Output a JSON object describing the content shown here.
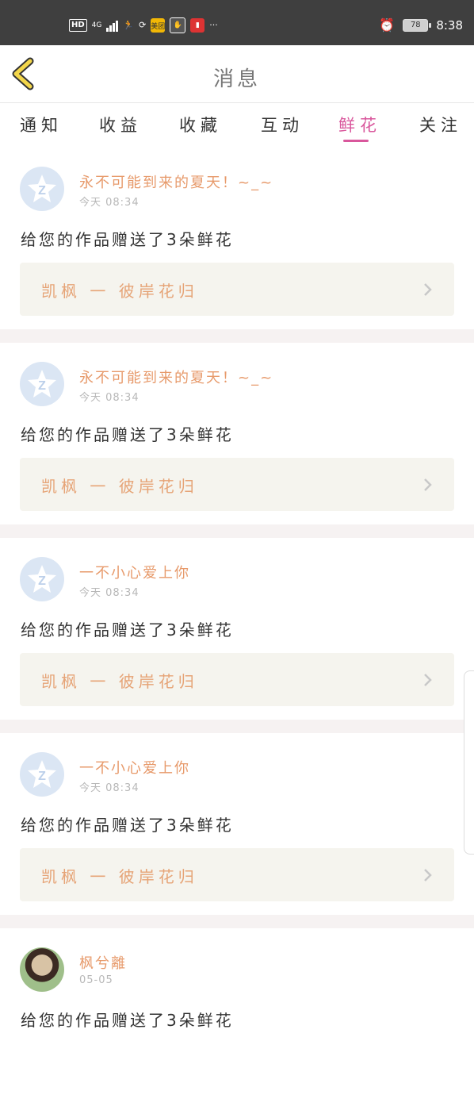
{
  "status_bar": {
    "hd": "HD",
    "net": "4G",
    "meituan": "美团",
    "dots": "···",
    "battery": "78",
    "time": "8:38"
  },
  "header": {
    "title": "消息"
  },
  "tabs": [
    {
      "label": "通知"
    },
    {
      "label": "收益"
    },
    {
      "label": "收藏"
    },
    {
      "label": "互动"
    },
    {
      "label": "鲜花",
      "active": true
    },
    {
      "label": "关注"
    }
  ],
  "messages": [
    {
      "user": "永不可能到来的夏天！~_~",
      "time": "今天 08:34",
      "text": "给您的作品赠送了3朵鲜花",
      "work": "凯枫 一 彼岸花归"
    },
    {
      "user": "永不可能到来的夏天！~_~",
      "time": "今天 08:34",
      "text": "给您的作品赠送了3朵鲜花",
      "work": "凯枫 一 彼岸花归"
    },
    {
      "user": "一不小心爱上你",
      "time": "今天 08:34",
      "text": "给您的作品赠送了3朵鲜花",
      "work": "凯枫 一 彼岸花归"
    },
    {
      "user": "一不小心爱上你",
      "time": "今天 08:34",
      "text": "给您的作品赠送了3朵鲜花",
      "work": "凯枫 一 彼岸花归"
    },
    {
      "user": "枫兮離",
      "time": "05-05",
      "text": "给您的作品赠送了3朵鲜花"
    }
  ],
  "colors": {
    "accent": "#d9579c",
    "username": "#e79a6b",
    "work_bg": "#f5f4ee"
  }
}
